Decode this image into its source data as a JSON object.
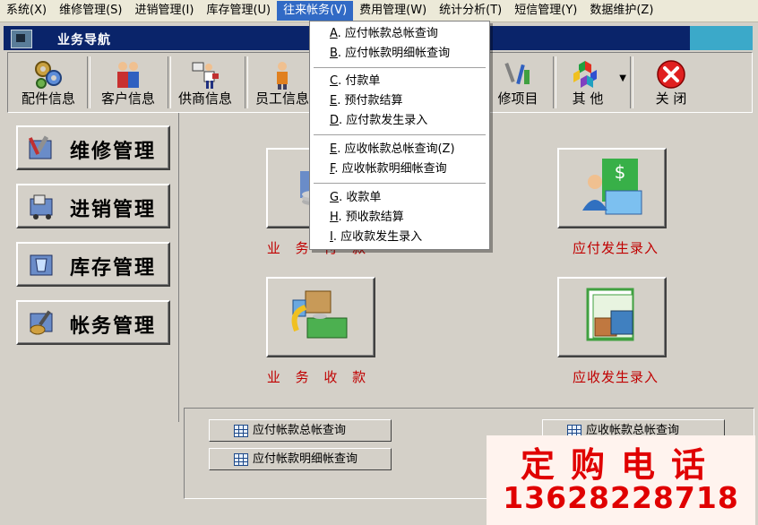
{
  "menubar": {
    "items": [
      "系统(X)",
      "维修管理(S)",
      "进销管理(I)",
      "库存管理(U)",
      "往来帐务(V)",
      "费用管理(W)",
      "统计分析(T)",
      "短信管理(Y)",
      "数据维护(Z)"
    ],
    "active_index": 4
  },
  "window": {
    "title": "业务导航"
  },
  "toolbar": {
    "items": [
      "配件信息",
      "客户信息",
      "供商信息",
      "员工信息",
      "修项目",
      "其  他",
      "关  闭"
    ]
  },
  "left_nav": {
    "items": [
      "维修管理",
      "进销管理",
      "库存管理",
      "帐务管理"
    ]
  },
  "main": {
    "buttons": [
      "业 务 付 款",
      "应付发生录入",
      "业 务 收 款",
      "应收发生录入"
    ]
  },
  "bottom": {
    "buttons": [
      "应付帐款总帐查询",
      "应付帐款明细帐查询",
      "应收帐款总帐查询"
    ]
  },
  "dropdown": {
    "items": [
      {
        "key": "A",
        "label": ". 应付帐款总帐查询"
      },
      {
        "key": "B",
        "label": ". 应付帐款明细帐查询"
      },
      {
        "key": "C",
        "label": ". 付款单"
      },
      {
        "key": "E",
        "label": ". 预付款结算"
      },
      {
        "key": "D",
        "label": ". 应付款发生录入"
      },
      {
        "key": "E",
        "label": ". 应收帐款总帐查询(Z)"
      },
      {
        "key": "F",
        "label": ". 应收帐款明细帐查询"
      },
      {
        "key": "G",
        "label": ". 收款单"
      },
      {
        "key": "H",
        "label": ". 预收款结算"
      },
      {
        "key": "I",
        "label": ". 应收款发生录入"
      }
    ]
  },
  "ad": {
    "headline": "定购电话",
    "phone": "13628228718"
  },
  "colors": {
    "menu_highlight": "#316ac5",
    "title_bar": "#0a246a",
    "label_red": "#c00000",
    "ad_red": "#e00000"
  }
}
